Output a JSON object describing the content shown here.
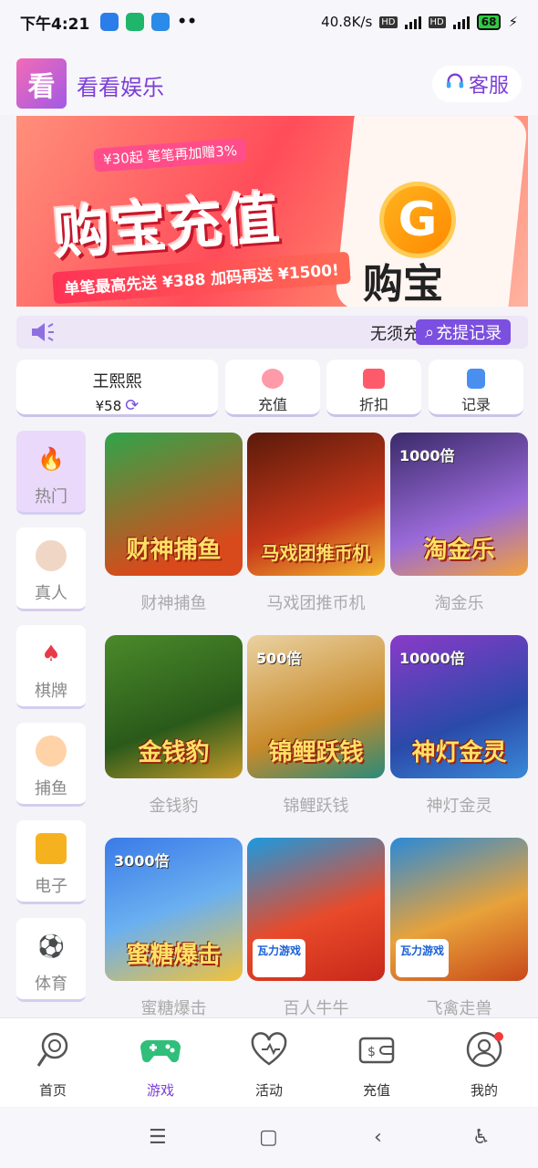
{
  "status_bar": {
    "time": "下午4:21",
    "net_speed": "40.8K/s",
    "battery": "68",
    "hd1": "HD",
    "hd2": "HD",
    "net1": "4G",
    "net2": "4G"
  },
  "header": {
    "logo_char": "看",
    "app_title": "看看娱乐",
    "service_label": "客服"
  },
  "banner": {
    "main_title": "购宝充值",
    "top_tag": "¥30起 笔笔再加赠3%",
    "bottom_tag": "单笔最高先送 ¥388  加码再送 ¥1500!",
    "brand": "购宝",
    "coin_char": "G"
  },
  "marquee": {
    "text": "无须充",
    "record_button": "充提记录"
  },
  "user": {
    "name": "王熙熙",
    "balance": "¥58"
  },
  "quick_actions": [
    {
      "label": "充值",
      "icon": "piggy-bank-icon"
    },
    {
      "label": "折扣",
      "icon": "discount-icon"
    },
    {
      "label": "记录",
      "icon": "record-icon"
    }
  ],
  "sidebar": {
    "items": [
      {
        "label": "热门",
        "icon": "fire-icon",
        "active": true
      },
      {
        "label": "真人",
        "icon": "dealer-icon"
      },
      {
        "label": "棋牌",
        "icon": "cards-icon"
      },
      {
        "label": "捕鱼",
        "icon": "fishing-icon"
      },
      {
        "label": "电子",
        "icon": "slot-icon"
      },
      {
        "label": "体育",
        "icon": "soccer-icon"
      }
    ]
  },
  "games": [
    {
      "name": "财神捕鱼",
      "title": "财神捕鱼",
      "mult": "",
      "color": "#d84a1b"
    },
    {
      "name": "马戏团推币机",
      "title": "马戏团推币机",
      "mult": "",
      "color": "#8a2a12"
    },
    {
      "name": "淘金乐",
      "title": "淘金乐",
      "mult": "1000倍",
      "color": "#6a3fa3"
    },
    {
      "name": "金钱豹",
      "title": "金钱豹",
      "mult": "",
      "color": "#3a6a22"
    },
    {
      "name": "锦鲤跃钱",
      "title": "锦鲤跃钱",
      "mult": "500倍",
      "color": "#c88a2a"
    },
    {
      "name": "神灯金灵",
      "title": "神灯金灵",
      "mult": "10000倍",
      "color": "#4a2a8a"
    },
    {
      "name": "蜜糖爆击",
      "title": "蜜糖爆击",
      "mult": "3000倍",
      "color": "#2a6ad8"
    },
    {
      "name": "百人牛牛",
      "title": "百人牛牛",
      "mult": "",
      "color": "#1a9ae0",
      "badge": "瓦力游戏"
    },
    {
      "name": "飞禽走兽",
      "title": "飞禽走兽",
      "mult": "",
      "color": "#2a8ad8",
      "badge": "瓦力游戏"
    }
  ],
  "bottom_nav": [
    {
      "label": "首页",
      "icon": "lollipop-icon"
    },
    {
      "label": "游戏",
      "icon": "gamepad-icon",
      "active": true
    },
    {
      "label": "活动",
      "icon": "heart-icon"
    },
    {
      "label": "充值",
      "icon": "wallet-icon"
    },
    {
      "label": "我的",
      "icon": "profile-icon"
    }
  ],
  "colors": {
    "accent": "#7b3fd6",
    "bg": "#f4f3f8"
  }
}
